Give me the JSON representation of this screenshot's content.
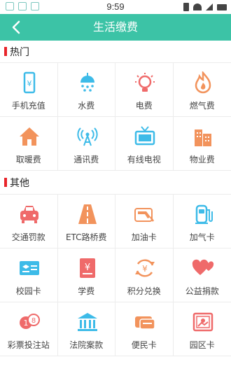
{
  "status_bar": {
    "time": "9:59"
  },
  "header": {
    "title": "生活缴费"
  },
  "sections": [
    {
      "title": "热门",
      "items": [
        {
          "label": "手机充值",
          "icon": "mobile-recharge-icon",
          "color": "#3dbbe8"
        },
        {
          "label": "水费",
          "icon": "shower-icon",
          "color": "#3dbbe8"
        },
        {
          "label": "电费",
          "icon": "lightbulb-icon",
          "color": "#ef6a6a"
        },
        {
          "label": "燃气费",
          "icon": "flame-icon",
          "color": "#f2935c"
        },
        {
          "label": "取暖费",
          "icon": "house-icon",
          "color": "#f2935c"
        },
        {
          "label": "通讯费",
          "icon": "antenna-icon",
          "color": "#3dbbe8"
        },
        {
          "label": "有线电视",
          "icon": "tv-icon",
          "color": "#3dbbe8"
        },
        {
          "label": "物业费",
          "icon": "building-icon",
          "color": "#f2935c"
        }
      ]
    },
    {
      "title": "其他",
      "items": [
        {
          "label": "交通罚款",
          "icon": "car-icon",
          "color": "#ef6a6a"
        },
        {
          "label": "ETC路桥费",
          "icon": "road-icon",
          "color": "#f2935c"
        },
        {
          "label": "加油卡",
          "icon": "fuel-nozzle-icon",
          "color": "#f2935c"
        },
        {
          "label": "加气卡",
          "icon": "gas-pump-icon",
          "color": "#3dbbe8"
        },
        {
          "label": "校园卡",
          "icon": "campus-card-icon",
          "color": "#3dbbe8"
        },
        {
          "label": "学费",
          "icon": "tuition-book-icon",
          "color": "#ef6a6a"
        },
        {
          "label": "积分兑换",
          "icon": "points-exchange-icon",
          "color": "#f2935c"
        },
        {
          "label": "公益捐款",
          "icon": "hearts-icon",
          "color": "#ef6a6a"
        },
        {
          "label": "彩票投注站",
          "icon": "lottery-ball-icon",
          "color": "#ef6a6a"
        },
        {
          "label": "法院案款",
          "icon": "courthouse-icon",
          "color": "#3dbbe8"
        },
        {
          "label": "便民卡",
          "icon": "wallet-card-icon",
          "color": "#f2935c"
        },
        {
          "label": "园区卡",
          "icon": "park-card-icon",
          "color": "#ef6a6a"
        }
      ]
    }
  ]
}
